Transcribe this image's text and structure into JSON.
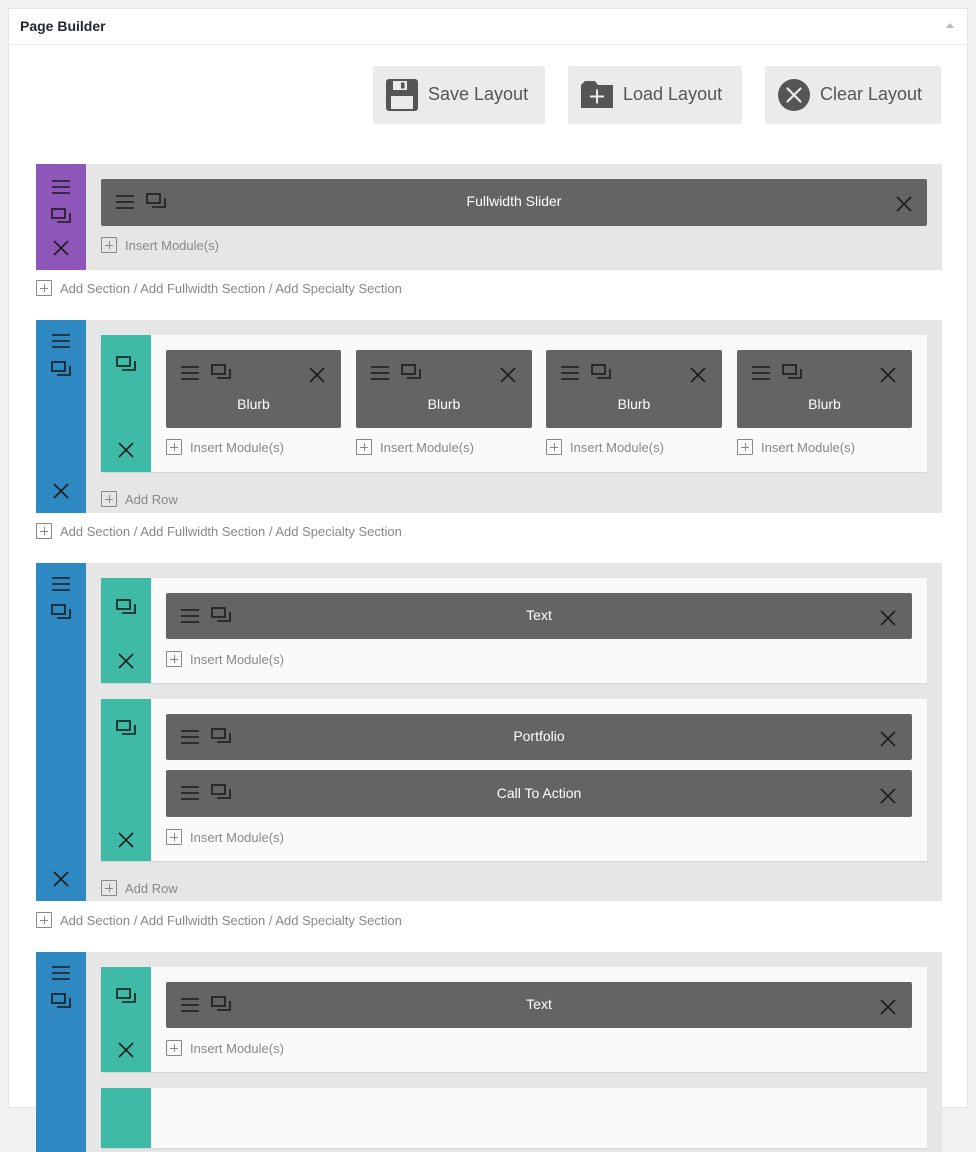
{
  "panel": {
    "title": "Page Builder"
  },
  "toolbar": {
    "save_label": "Save Layout",
    "load_label": "Load Layout",
    "clear_label": "Clear Layout"
  },
  "links": {
    "insert_module": "Insert Module(s)",
    "add_row": "Add Row",
    "add_section": "Add Section / Add Fullwidth Section / Add Specialty Section"
  },
  "sections": [
    {
      "type": "fullwidth",
      "modules": [
        "Fullwidth Slider"
      ]
    },
    {
      "type": "regular",
      "rows": [
        {
          "columns": [
            "Blurb",
            "Blurb",
            "Blurb",
            "Blurb"
          ]
        }
      ]
    },
    {
      "type": "regular",
      "rows": [
        {
          "modules": [
            "Text"
          ]
        },
        {
          "modules": [
            "Portfolio",
            "Call To Action"
          ]
        }
      ]
    },
    {
      "type": "regular",
      "rows": [
        {
          "modules": [
            "Text"
          ]
        }
      ]
    }
  ],
  "colors": {
    "fullwidth_section": "#8e56b8",
    "regular_section": "#2e88c2",
    "row": "#3ebaa6",
    "module": "#646464"
  },
  "icons": [
    "floppy-disk-icon",
    "folder-plus-icon",
    "close-circle-icon",
    "hamburger-icon",
    "duplicate-icon",
    "close-icon",
    "plus-square-icon",
    "collapse-arrow-icon"
  ]
}
